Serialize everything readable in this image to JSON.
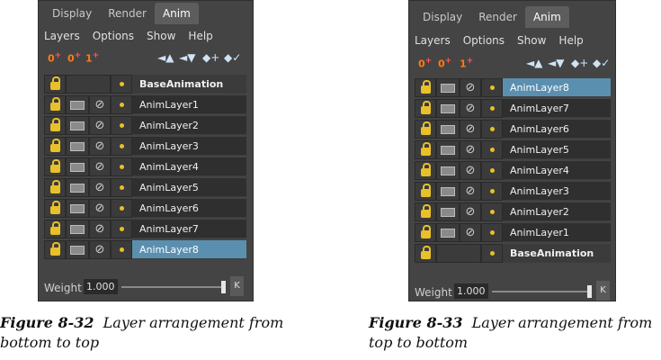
{
  "panel_left": {
    "tabs": [
      "Display",
      "Render",
      "Anim"
    ],
    "menu": [
      "Layers",
      "Options",
      "Show",
      "Help"
    ],
    "toolbar_left": [
      "0",
      "0",
      "1"
    ],
    "layers": [
      "BaseAnimation",
      "AnimLayer1",
      "AnimLayer2",
      "AnimLayer3",
      "AnimLayer4",
      "AnimLayer5",
      "AnimLayer6",
      "AnimLayer7",
      "AnimLayer8"
    ],
    "selected": "AnimLayer8",
    "weight_label": "Weight",
    "weight_value": "1.000",
    "k_label": "K"
  },
  "panel_right": {
    "tabs": [
      "Display",
      "Render",
      "Anim"
    ],
    "menu": [
      "Layers",
      "Options",
      "Show",
      "Help"
    ],
    "toolbar_left": [
      "0",
      "0",
      "1"
    ],
    "layers": [
      "AnimLayer8",
      "AnimLayer7",
      "AnimLayer6",
      "AnimLayer5",
      "AnimLayer4",
      "AnimLayer3",
      "AnimLayer2",
      "AnimLayer1",
      "BaseAnimation"
    ],
    "selected": "AnimLayer8",
    "weight_label": "Weight",
    "weight_value": "1.000",
    "k_label": "K"
  },
  "captions": {
    "left_label": "Figure 8-32",
    "left_text_1": "Layer arrangement from",
    "left_text_2": "bottom to top",
    "right_label": "Figure 8-33",
    "right_text_1": "Layer arrangement from",
    "right_text_2": "top to bottom"
  }
}
